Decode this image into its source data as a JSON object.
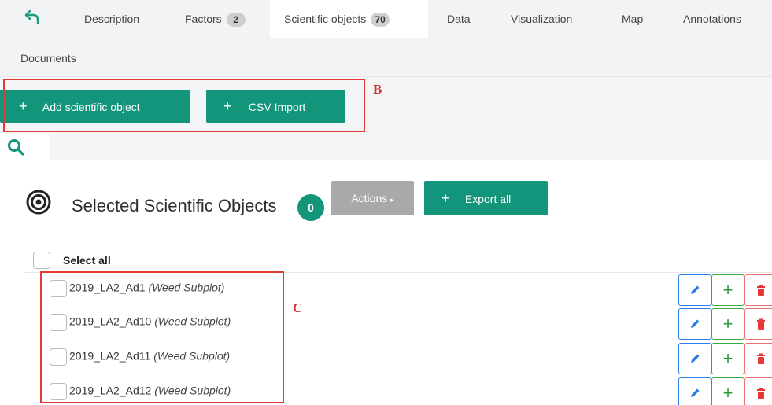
{
  "tabs": [
    {
      "label": "Description",
      "badge": null
    },
    {
      "label": "Factors",
      "badge": "2"
    },
    {
      "label": "Scientific objects",
      "badge": "70"
    },
    {
      "label": "Data",
      "badge": null
    },
    {
      "label": "Visualization",
      "badge": null
    },
    {
      "label": "Map",
      "badge": null
    },
    {
      "label": "Annotations",
      "badge": null
    },
    {
      "label": "Documents",
      "badge": null
    }
  ],
  "active_tab": "Scientific objects",
  "toolbar": {
    "add_label": "Add scientific object",
    "csv_label": "CSV Import",
    "annotation_b": "B"
  },
  "selected": {
    "title": "Selected Scientific Objects",
    "count": "0",
    "actions_label": "Actions",
    "export_label": "Export all"
  },
  "list": {
    "select_all_label": "Select all",
    "annotation_c": "C",
    "items": [
      {
        "name": "2019_LA2_Ad1",
        "type": "(Weed Subplot)"
      },
      {
        "name": "2019_LA2_Ad10",
        "type": "(Weed Subplot)"
      },
      {
        "name": "2019_LA2_Ad11",
        "type": "(Weed Subplot)"
      },
      {
        "name": "2019_LA2_Ad12",
        "type": "(Weed Subplot)"
      }
    ]
  },
  "icons": [
    "back-arrow-icon",
    "plus-icon",
    "search-icon",
    "target-icon",
    "caret-right-icon",
    "pencil-icon",
    "trash-icon"
  ],
  "colors": {
    "accent": "#12957b",
    "annotation": "#e53935",
    "edit": "#2b7de9",
    "add": "#3aa845",
    "delete": "#e57373"
  }
}
